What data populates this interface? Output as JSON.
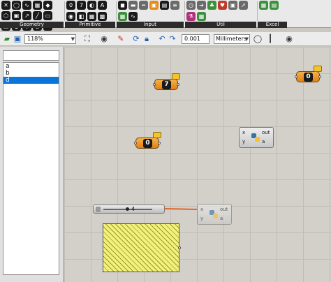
{
  "ribbon": {
    "groups": [
      {
        "label": "Geometry",
        "icons": [
          "point",
          "circle",
          "curve",
          "surface",
          "brep",
          "mesh",
          "field",
          "vector",
          "line",
          "plane",
          "box",
          "sphere",
          "geom-misc",
          "geom-misc-2",
          "geom-misc-3",
          "geom-misc-4",
          "x"
        ]
      },
      {
        "label": "Primitive",
        "icons": [
          "number",
          "integer",
          "bool",
          "string",
          "colour",
          "domain",
          "matrix",
          "data"
        ]
      },
      {
        "label": "Input",
        "icons": [
          "button",
          "toggle",
          "slider",
          "panel",
          "swatch",
          "list",
          "value",
          "graph"
        ]
      },
      {
        "label": "Util",
        "icons": [
          "clock",
          "arrow",
          "leaf",
          "cherry",
          "cluster",
          "jump",
          "flask",
          "gate"
        ]
      },
      {
        "label": "Excel",
        "icons": [
          "read",
          "write"
        ]
      }
    ],
    "accent": "#2b2b2b"
  },
  "toolbar": {
    "zoom": "118%",
    "tolerance": "0.001",
    "units": "Millimeters"
  },
  "list": {
    "items": [
      "a",
      "b",
      "d"
    ],
    "selected": "d",
    "selected_color": "#0a74da"
  },
  "canvas": {
    "nodes": [
      {
        "type": "integer-param",
        "glyph": "7"
      },
      {
        "type": "integer-param",
        "glyph": "0"
      },
      {
        "type": "number-param",
        "glyph": "0"
      }
    ],
    "python_nodes": [
      {
        "inputs": [
          "x",
          "y"
        ],
        "outputs": [
          "out",
          "a"
        ]
      },
      {
        "inputs": [
          "x",
          "y"
        ],
        "outputs": [
          "out",
          "a"
        ]
      }
    ],
    "slider": {
      "value": "4"
    },
    "wire_color": "#e8622a",
    "panel_color": "#f2f27a"
  }
}
